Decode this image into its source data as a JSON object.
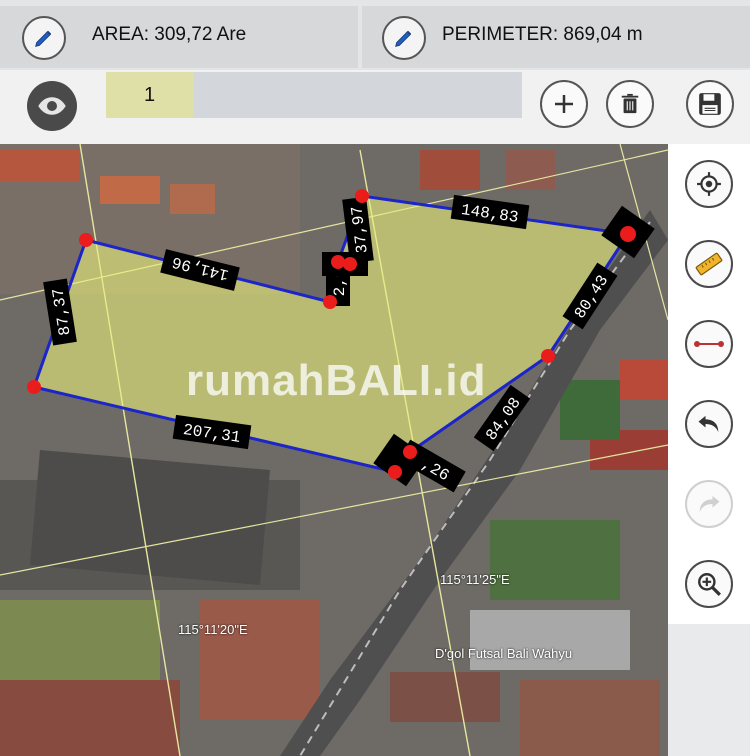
{
  "header": {
    "area_text": "AREA: 309,72 Are",
    "perimeter_text": "PERIMETER: 869,04 m",
    "area_edit_icon": "pencil-icon",
    "perimeter_edit_icon": "pencil-icon"
  },
  "toolbar": {
    "visibility_icon": "eye-icon",
    "layer_label": "1",
    "add_icon": "plus-icon",
    "delete_icon": "trash-icon",
    "save_icon": "floppy-disk-icon"
  },
  "sidebar": {
    "buttons": [
      {
        "icon": "locate-icon"
      },
      {
        "icon": "ruler-icon"
      },
      {
        "icon": "line-segment-icon"
      },
      {
        "icon": "undo-icon"
      },
      {
        "icon": "redo-icon",
        "disabled": true
      },
      {
        "icon": "zoom-in-icon"
      }
    ]
  },
  "map": {
    "watermark": "rumahBALI.id",
    "edge_labels": [
      "148,83",
      "80,43",
      "84,08",
      "1,26",
      "207,31",
      "87,37",
      "141,96",
      "2,9",
      "37,97"
    ],
    "coords": [
      "115°11'25\"E",
      "115°11'20\"E"
    ],
    "place_label": "D'gol Futsal Bali Wahyu",
    "colors": {
      "polygon_fill": "#e7ee7a",
      "polygon_edge": "#1c25c8",
      "vertex": "#ea1c1c"
    }
  }
}
